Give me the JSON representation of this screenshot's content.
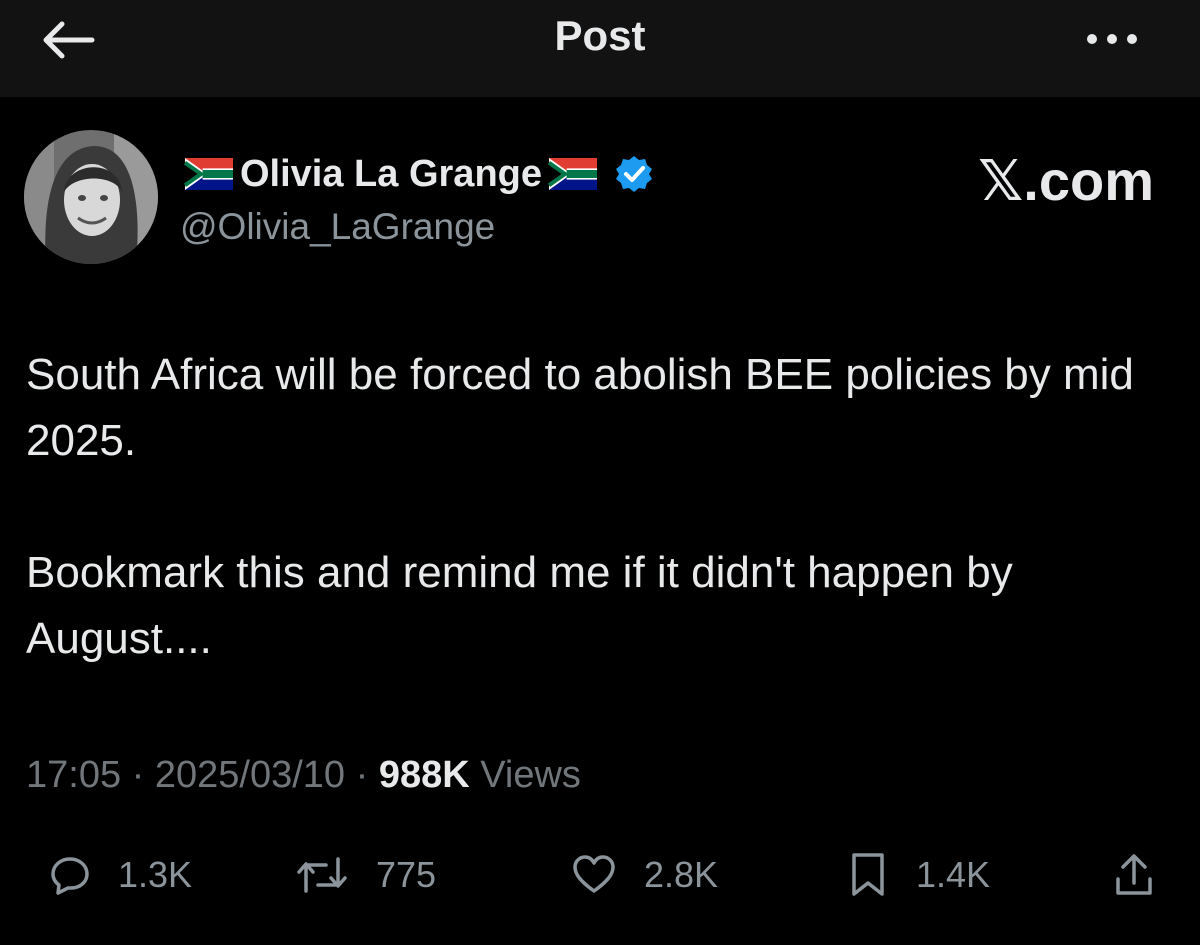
{
  "header": {
    "title": "Post",
    "back_icon": "arrow-left-icon",
    "more_icon": "more-horizontal-icon"
  },
  "author": {
    "display_name": "Olivia La Grange",
    "handle": "@Olivia_LaGrange",
    "verified": true,
    "verified_color": "#1d9bf0",
    "name_decoration_icon": "south-africa-flag-icon"
  },
  "watermark": "𝕏.com",
  "post": {
    "paragraphs": [
      "South Africa will be forced to abolish BEE policies by mid 2025.",
      "Bookmark this and remind me if it didn't happen by August...."
    ]
  },
  "meta": {
    "time": "17:05",
    "separator": " · ",
    "date": "2025/03/10",
    "views_count": "988K",
    "views_label": "Views"
  },
  "actions": {
    "replies": "1.3K",
    "reposts": "775",
    "likes": "2.8K",
    "bookmarks": "1.4K"
  },
  "colors": {
    "background": "#000000",
    "header_background": "#121212",
    "text_primary": "#e7e9ea",
    "text_secondary": "#71767b"
  }
}
